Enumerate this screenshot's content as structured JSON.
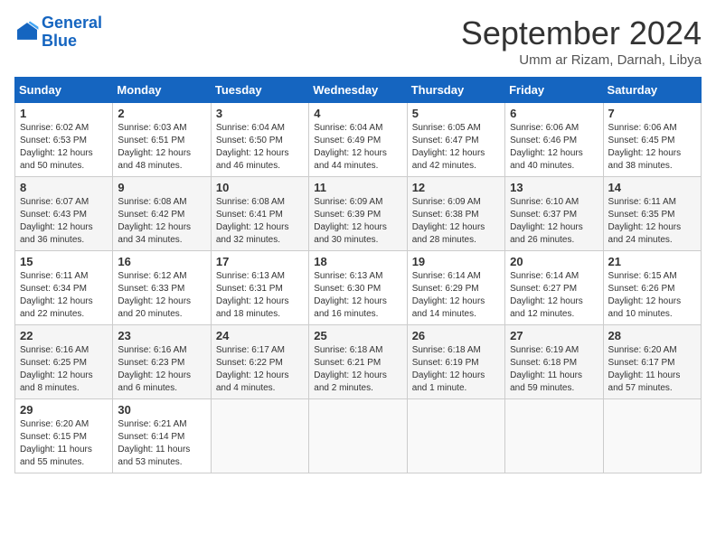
{
  "header": {
    "logo_line1": "General",
    "logo_line2": "Blue",
    "month": "September 2024",
    "location": "Umm ar Rizam, Darnah, Libya"
  },
  "days_of_week": [
    "Sunday",
    "Monday",
    "Tuesday",
    "Wednesday",
    "Thursday",
    "Friday",
    "Saturday"
  ],
  "weeks": [
    [
      {
        "day": "1",
        "sunrise": "6:02 AM",
        "sunset": "6:53 PM",
        "daylight": "12 hours and 50 minutes."
      },
      {
        "day": "2",
        "sunrise": "6:03 AM",
        "sunset": "6:51 PM",
        "daylight": "12 hours and 48 minutes."
      },
      {
        "day": "3",
        "sunrise": "6:04 AM",
        "sunset": "6:50 PM",
        "daylight": "12 hours and 46 minutes."
      },
      {
        "day": "4",
        "sunrise": "6:04 AM",
        "sunset": "6:49 PM",
        "daylight": "12 hours and 44 minutes."
      },
      {
        "day": "5",
        "sunrise": "6:05 AM",
        "sunset": "6:47 PM",
        "daylight": "12 hours and 42 minutes."
      },
      {
        "day": "6",
        "sunrise": "6:06 AM",
        "sunset": "6:46 PM",
        "daylight": "12 hours and 40 minutes."
      },
      {
        "day": "7",
        "sunrise": "6:06 AM",
        "sunset": "6:45 PM",
        "daylight": "12 hours and 38 minutes."
      }
    ],
    [
      {
        "day": "8",
        "sunrise": "6:07 AM",
        "sunset": "6:43 PM",
        "daylight": "12 hours and 36 minutes."
      },
      {
        "day": "9",
        "sunrise": "6:08 AM",
        "sunset": "6:42 PM",
        "daylight": "12 hours and 34 minutes."
      },
      {
        "day": "10",
        "sunrise": "6:08 AM",
        "sunset": "6:41 PM",
        "daylight": "12 hours and 32 minutes."
      },
      {
        "day": "11",
        "sunrise": "6:09 AM",
        "sunset": "6:39 PM",
        "daylight": "12 hours and 30 minutes."
      },
      {
        "day": "12",
        "sunrise": "6:09 AM",
        "sunset": "6:38 PM",
        "daylight": "12 hours and 28 minutes."
      },
      {
        "day": "13",
        "sunrise": "6:10 AM",
        "sunset": "6:37 PM",
        "daylight": "12 hours and 26 minutes."
      },
      {
        "day": "14",
        "sunrise": "6:11 AM",
        "sunset": "6:35 PM",
        "daylight": "12 hours and 24 minutes."
      }
    ],
    [
      {
        "day": "15",
        "sunrise": "6:11 AM",
        "sunset": "6:34 PM",
        "daylight": "12 hours and 22 minutes."
      },
      {
        "day": "16",
        "sunrise": "6:12 AM",
        "sunset": "6:33 PM",
        "daylight": "12 hours and 20 minutes."
      },
      {
        "day": "17",
        "sunrise": "6:13 AM",
        "sunset": "6:31 PM",
        "daylight": "12 hours and 18 minutes."
      },
      {
        "day": "18",
        "sunrise": "6:13 AM",
        "sunset": "6:30 PM",
        "daylight": "12 hours and 16 minutes."
      },
      {
        "day": "19",
        "sunrise": "6:14 AM",
        "sunset": "6:29 PM",
        "daylight": "12 hours and 14 minutes."
      },
      {
        "day": "20",
        "sunrise": "6:14 AM",
        "sunset": "6:27 PM",
        "daylight": "12 hours and 12 minutes."
      },
      {
        "day": "21",
        "sunrise": "6:15 AM",
        "sunset": "6:26 PM",
        "daylight": "12 hours and 10 minutes."
      }
    ],
    [
      {
        "day": "22",
        "sunrise": "6:16 AM",
        "sunset": "6:25 PM",
        "daylight": "12 hours and 8 minutes."
      },
      {
        "day": "23",
        "sunrise": "6:16 AM",
        "sunset": "6:23 PM",
        "daylight": "12 hours and 6 minutes."
      },
      {
        "day": "24",
        "sunrise": "6:17 AM",
        "sunset": "6:22 PM",
        "daylight": "12 hours and 4 minutes."
      },
      {
        "day": "25",
        "sunrise": "6:18 AM",
        "sunset": "6:21 PM",
        "daylight": "12 hours and 2 minutes."
      },
      {
        "day": "26",
        "sunrise": "6:18 AM",
        "sunset": "6:19 PM",
        "daylight": "12 hours and 1 minute."
      },
      {
        "day": "27",
        "sunrise": "6:19 AM",
        "sunset": "6:18 PM",
        "daylight": "11 hours and 59 minutes."
      },
      {
        "day": "28",
        "sunrise": "6:20 AM",
        "sunset": "6:17 PM",
        "daylight": "11 hours and 57 minutes."
      }
    ],
    [
      {
        "day": "29",
        "sunrise": "6:20 AM",
        "sunset": "6:15 PM",
        "daylight": "11 hours and 55 minutes."
      },
      {
        "day": "30",
        "sunrise": "6:21 AM",
        "sunset": "6:14 PM",
        "daylight": "11 hours and 53 minutes."
      },
      null,
      null,
      null,
      null,
      null
    ]
  ]
}
